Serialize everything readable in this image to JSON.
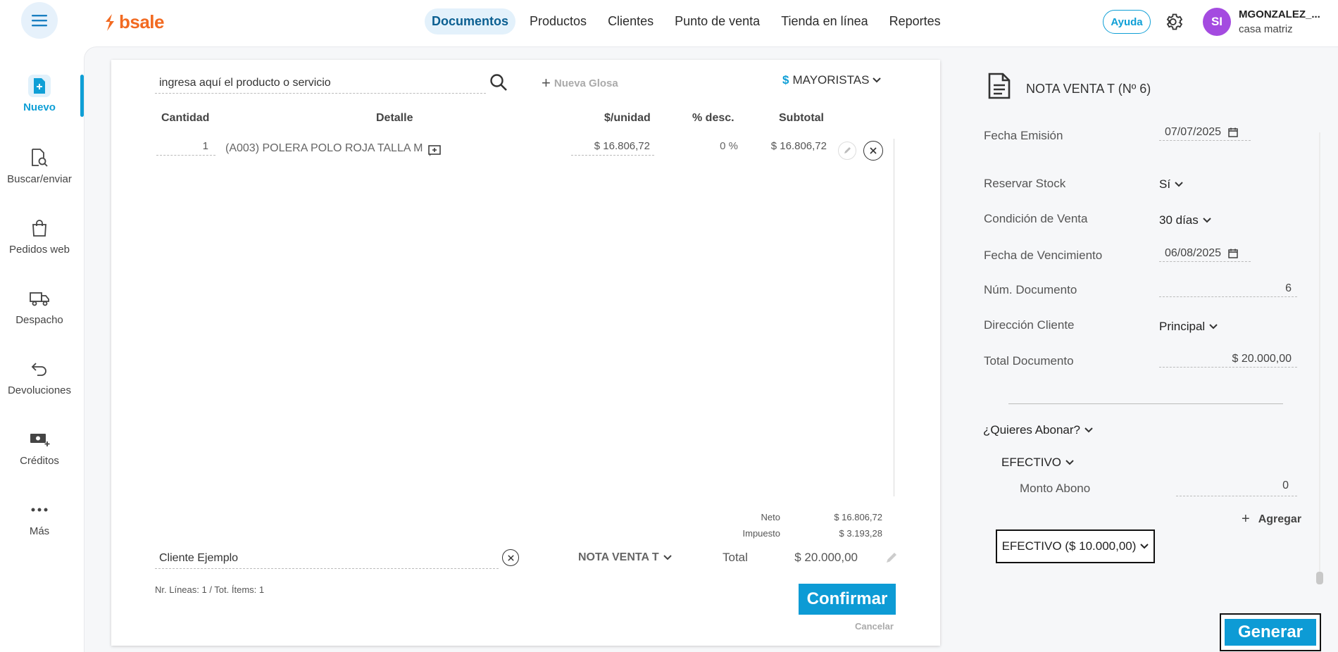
{
  "header": {
    "logo_text": "bsale",
    "brand_color": "#f26a21",
    "accent_color": "#0f9fd6",
    "nav": [
      {
        "label": "Documentos",
        "active": true
      },
      {
        "label": "Productos",
        "active": false
      },
      {
        "label": "Clientes",
        "active": false
      },
      {
        "label": "Punto de venta",
        "active": false
      },
      {
        "label": "Tienda en línea",
        "active": false
      },
      {
        "label": "Reportes",
        "active": false
      }
    ],
    "help_label": "Ayuda",
    "avatar_initials": "SI",
    "user_name": "MGONZALEZ_...",
    "user_branch": "casa matriz"
  },
  "sidebar": {
    "items": [
      {
        "label": "Nuevo",
        "icon": "new-document-icon",
        "active": true
      },
      {
        "label": "Buscar/enviar",
        "icon": "search-document-icon",
        "active": false
      },
      {
        "label": "Pedidos web",
        "icon": "shopping-bag-icon",
        "active": false
      },
      {
        "label": "Despacho",
        "icon": "truck-icon",
        "active": false
      },
      {
        "label": "Devoluciones",
        "icon": "return-arrow-icon",
        "active": false
      },
      {
        "label": "Créditos",
        "icon": "cash-plus-icon",
        "active": false
      },
      {
        "label": "Más",
        "icon": "more-dots-icon",
        "active": false
      }
    ]
  },
  "editor": {
    "search_placeholder": "ingresa aquí el producto o servicio",
    "nueva_glosa": "Nueva Glosa",
    "price_list_symbol": "$",
    "price_list": "MAYORISTAS",
    "columns": {
      "cantidad": "Cantidad",
      "detalle": "Detalle",
      "unit_price": "$/unidad",
      "discount": "% desc.",
      "subtotal": "Subtotal"
    },
    "rows": [
      {
        "qty": "1",
        "detail": "(A003) POLERA POLO ROJA TALLA M",
        "unit_price": "$ 16.806,72",
        "discount": "0 %",
        "subtotal": "$ 16.806,72"
      }
    ],
    "totals": {
      "neto_label": "Neto",
      "neto_value": "$ 16.806,72",
      "impuesto_label": "Impuesto",
      "impuesto_value": "$ 3.193,28",
      "total_label": "Total",
      "total_value": "$ 20.000,00"
    },
    "client_value": "Cliente Ejemplo",
    "doc_type": "NOTA VENTA T",
    "lines_info": "Nr. Líneas: 1 / Tot. Ítems: 1",
    "confirm_label": "Confirmar",
    "cancel_label": "Cancelar"
  },
  "panel": {
    "title": "NOTA VENTA T (Nº 6)",
    "fecha_emision_label": "Fecha Emisión",
    "fecha_emision_value": "07/07/2025",
    "reservar_stock_label": "Reservar Stock",
    "reservar_stock_value": "Sí",
    "condicion_label": "Condición de Venta",
    "condicion_value": "30 días",
    "vencimiento_label": "Fecha de Vencimiento",
    "vencimiento_value": "06/08/2025",
    "num_doc_label": "Núm. Documento",
    "num_doc_value": "6",
    "direccion_label": "Dirección Cliente",
    "direccion_value": "Principal",
    "total_doc_label": "Total Documento",
    "total_doc_value": "$ 20.000,00",
    "abonar_label": "¿Quieres Abonar?",
    "payment_method": "EFECTIVO",
    "monto_label": "Monto Abono",
    "monto_value": "0",
    "agregar_label": "Agregar",
    "payment_chip": "EFECTIVO ($ 10.000,00)",
    "generar_label": "Generar"
  }
}
